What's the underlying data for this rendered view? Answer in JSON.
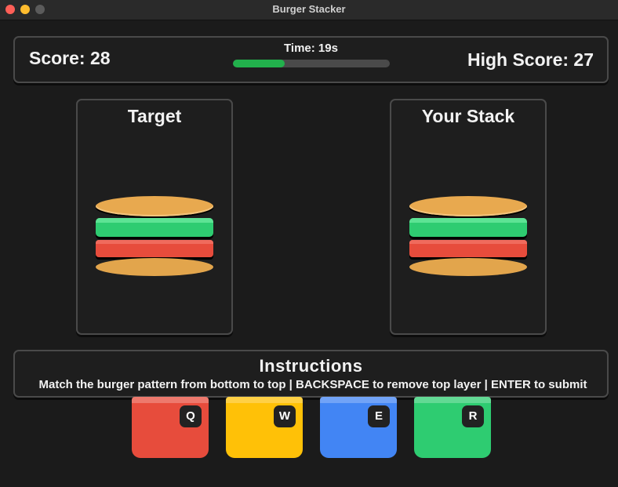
{
  "window": {
    "title": "Burger Stacker"
  },
  "hud": {
    "score_text": "Score: 28",
    "high_score_text": "High Score: 27",
    "time_text": "Time: 19s",
    "time_progress": 0.33
  },
  "panels": {
    "target_title": "Target",
    "stack_title": "Your Stack"
  },
  "burger_layers_bottom_to_top": [
    "bottom-bun",
    "tomato",
    "lettuce",
    "top-bun"
  ],
  "instructions": {
    "title": "Instructions",
    "text": "Match the burger pattern from bottom to top | BACKSPACE to remove top layer | ENTER to submit"
  },
  "keys": [
    {
      "label": "Q",
      "color": "#e74c3c"
    },
    {
      "label": "W",
      "color": "#ffc107"
    },
    {
      "label": "E",
      "color": "#4285f4"
    },
    {
      "label": "R",
      "color": "#2ecc71"
    }
  ],
  "colors": {
    "background": "#1b1b1b",
    "bun": "#e8a94f",
    "lettuce": "#2ecc71",
    "tomato": "#e74c3c",
    "timer": "#22b14c"
  }
}
